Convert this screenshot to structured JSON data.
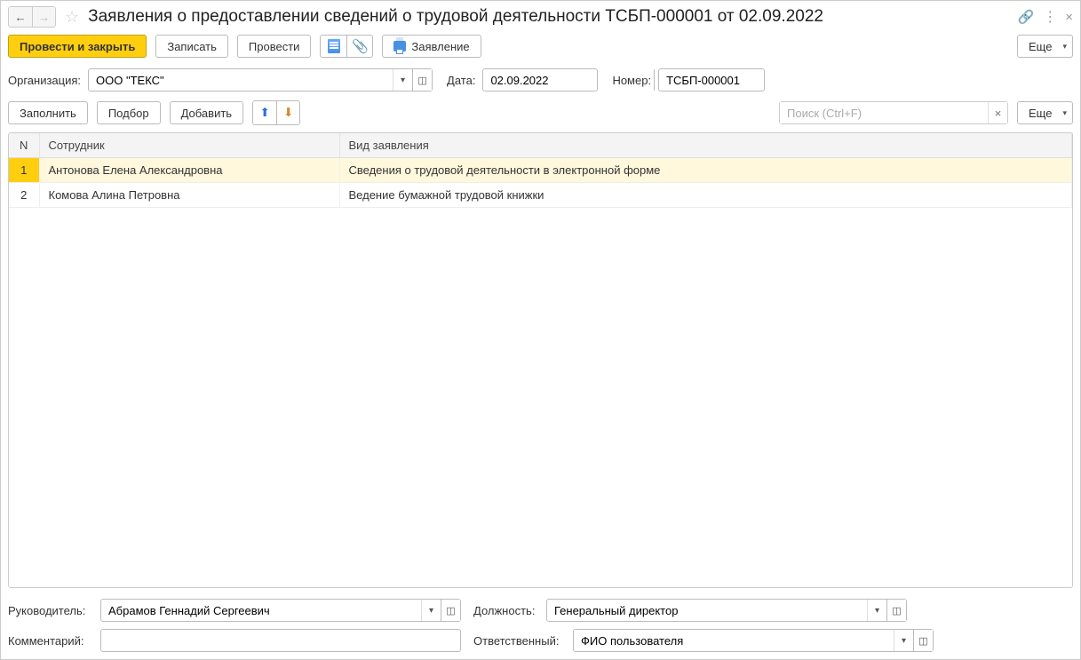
{
  "title": "Заявления о предоставлении сведений о трудовой деятельности ТСБП-000001 от 02.09.2022",
  "toolbar": {
    "post_and_close": "Провести и закрыть",
    "save": "Записать",
    "post": "Провести",
    "application": "Заявление",
    "more": "Еще"
  },
  "form": {
    "org_label": "Организация:",
    "org_value": "ООО \"ТЕКС\"",
    "date_label": "Дата:",
    "date_value": "02.09.2022",
    "number_label": "Номер:",
    "number_value": "ТСБП-000001"
  },
  "subtoolbar": {
    "fill": "Заполнить",
    "pick": "Подбор",
    "add": "Добавить",
    "search_placeholder": "Поиск (Ctrl+F)",
    "more": "Еще"
  },
  "table": {
    "col_n": "N",
    "col_emp": "Сотрудник",
    "col_type": "Вид заявления",
    "rows": [
      {
        "n": "1",
        "emp": "Антонова Елена Александровна",
        "type": "Сведения о трудовой деятельности в электронной форме"
      },
      {
        "n": "2",
        "emp": "Комова Алина Петровна",
        "type": "Ведение бумажной трудовой книжки"
      }
    ]
  },
  "footer": {
    "manager_label": "Руководитель:",
    "manager_value": "Абрамов Геннадий Сергеевич",
    "position_label": "Должность:",
    "position_value": "Генеральный директор",
    "comment_label": "Комментарий:",
    "comment_value": "",
    "responsible_label": "Ответственный:",
    "responsible_value": "ФИО пользователя"
  }
}
